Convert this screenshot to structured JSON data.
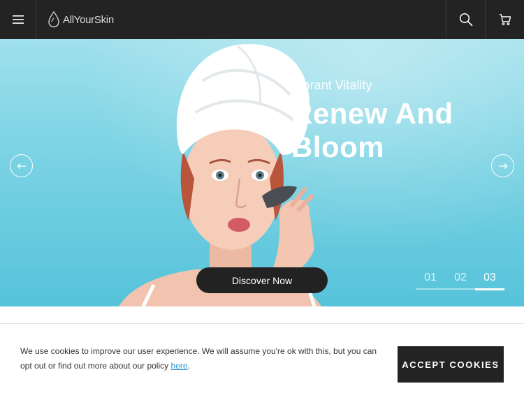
{
  "header": {
    "brand": "AllYourSkin",
    "icons": {
      "menu": "hamburger-menu-icon",
      "logo": "water-drop-icon",
      "search": "search-icon",
      "cart": "shopping-cart-icon"
    }
  },
  "hero": {
    "subtitle": "Vibrant Vitality",
    "title": "Renew And Bloom",
    "cta_label": "Discover Now",
    "slides": [
      "01",
      "02",
      "03"
    ],
    "active_slide": "03",
    "icons": {
      "prev": "arrow-left-icon",
      "next": "arrow-right-icon"
    }
  },
  "cookie_banner": {
    "text_before_link": "We use cookies to improve our user experience. We will assume you're ok with this, but you can opt out or find out more about our policy ",
    "link_text": "here",
    "text_after_link": ".",
    "accept_label": "ACCEPT COOKIES"
  },
  "colors": {
    "header_bg": "#232323",
    "hero_bg": "#79d2e3",
    "button_dark": "#222222",
    "link": "#2b8fd6"
  }
}
